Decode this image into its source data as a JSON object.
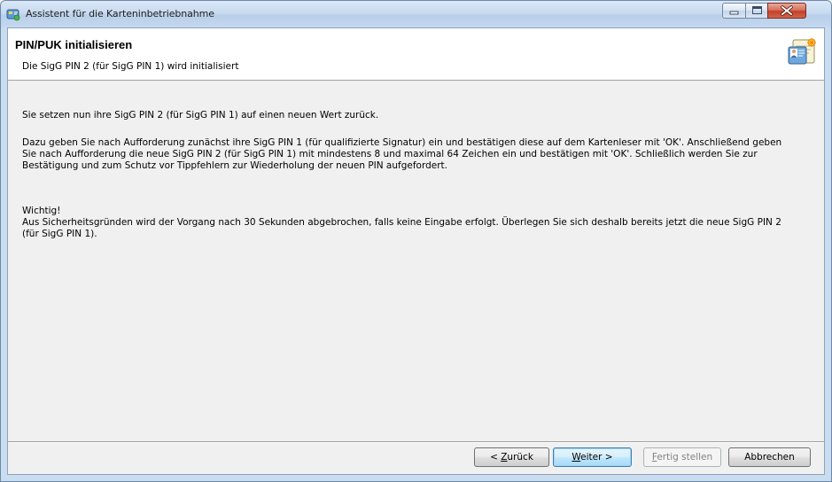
{
  "window": {
    "title": "Assistent für die Karteninbetriebnahme"
  },
  "header": {
    "title": "PIN/PUK initialisieren",
    "subtitle": "Die SigG PIN 2 (für SigG PIN 1) wird initialisiert"
  },
  "body": {
    "paragraph1": "Sie setzen nun ihre SigG PIN 2 (für SigG PIN 1) auf einen neuen Wert zurück.",
    "paragraph2_lines": [
      "Dazu geben Sie nach Aufforderung zunächst ihre SigG PIN 1 (für qualifizierte Signatur) ein und bestätigen diese auf dem Kartenleser mit 'OK'. Anschließend geben",
      "Sie nach Aufforderung die neue SigG PIN 2 (für SigG PIN 1) mit mindestens 8 und maximal 64 Zeichen ein und bestätigen mit 'OK'. Schließlich werden Sie zur",
      "Bestätigung und zum Schutz vor Tippfehlern zur Wiederholung der neuen PIN aufgefordert."
    ],
    "paragraph3_lines": [
      "Wichtig!",
      "Aus Sicherheitsgründen wird der Vorgang nach 30 Sekunden abgebrochen, falls keine Eingabe erfolgt. Überlegen Sie sich deshalb bereits jetzt die neue SigG PIN 2",
      "(für SigG PIN 1)."
    ]
  },
  "buttons": {
    "back": {
      "prefix": "< ",
      "mnemonic": "Z",
      "rest": "urück"
    },
    "next": {
      "mnemonic": "W",
      "rest": "eiter >"
    },
    "finish": {
      "mnemonic": "F",
      "rest": "ertig stellen"
    },
    "cancel": {
      "label": "Abbrechen"
    }
  },
  "icons": {
    "title_icon": "card-wizard-icon",
    "header_icon": "id-card-icon",
    "minimize": "minimize-icon",
    "maximize": "maximize-icon",
    "close": "close-icon"
  },
  "colors": {
    "titlebar": "#c8daf0",
    "client_bg": "#f0f0f0",
    "header_bg": "#ffffff",
    "close_button": "#c3402a",
    "default_button_border": "#3c7fb1"
  }
}
